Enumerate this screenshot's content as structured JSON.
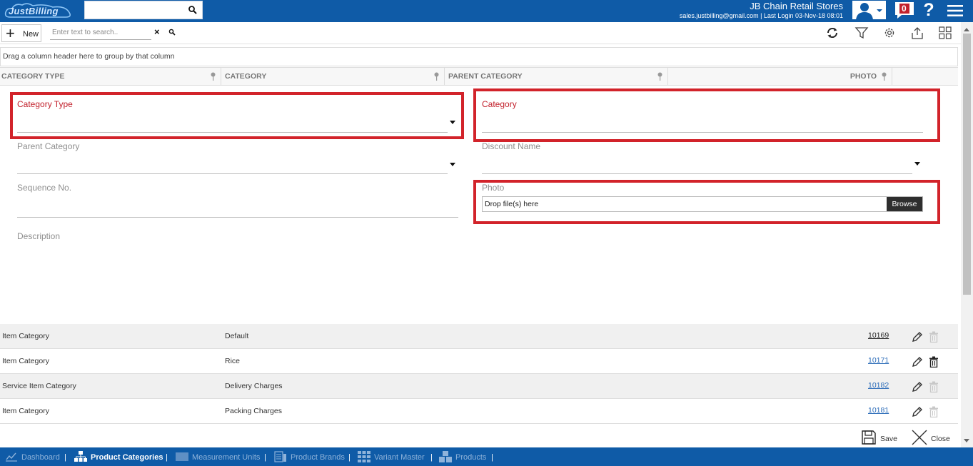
{
  "header": {
    "logo_text": "JustBilling",
    "store_name": "JB Chain Retail Stores",
    "login_info": "sales.justbilling@gmail.com | Last Login 03-Nov-18 08:01",
    "notification_count": "0",
    "help_glyph": "?"
  },
  "toolbar": {
    "new_label": "New",
    "search_placeholder": "Enter text to search..",
    "icons": [
      "refresh-icon",
      "filter-icon",
      "settings-icon",
      "export-icon",
      "grid-layout-icon"
    ]
  },
  "grid": {
    "group_hint": "Drag a column header here to group by that column",
    "columns": [
      "CATEGORY TYPE",
      "CATEGORY",
      "PARENT CATEGORY",
      "PHOTO"
    ]
  },
  "form": {
    "category_type_label": "Category Type",
    "category_label": "Category",
    "parent_category_label": "Parent Category",
    "discount_name_label": "Discount Name",
    "sequence_label": "Sequence No.",
    "photo_label": "Photo",
    "photo_drop_text": "Drop file(s) here",
    "browse_label": "Browse",
    "description_label": "Description"
  },
  "rows": [
    {
      "category_type": "Item Category",
      "category": "Default",
      "photo": "10169"
    },
    {
      "category_type": "Item Category",
      "category": "Rice",
      "photo": "10171"
    },
    {
      "category_type": "Service Item Category",
      "category": "Delivery Charges",
      "photo": "10182"
    },
    {
      "category_type": "Item Category",
      "category": "Packing Charges",
      "photo": "10181"
    }
  ],
  "actions": {
    "save_label": "Save",
    "close_label": "Close"
  },
  "bottom_nav": [
    {
      "label": "Dashboard",
      "icon": "dashboard-icon"
    },
    {
      "label": "Product Categories",
      "icon": "categories-icon"
    },
    {
      "label": "Measurement Units",
      "icon": "measurement-icon"
    },
    {
      "label": "Product Brands",
      "icon": "brands-icon"
    },
    {
      "label": "Variant Master",
      "icon": "variant-icon"
    },
    {
      "label": "Products",
      "icon": "products-icon"
    }
  ],
  "colors": {
    "brand_blue": "#0f5ba7",
    "required_red": "#c2212c",
    "highlight_red": "#d2232a",
    "link_blue": "#2a6bb8"
  }
}
